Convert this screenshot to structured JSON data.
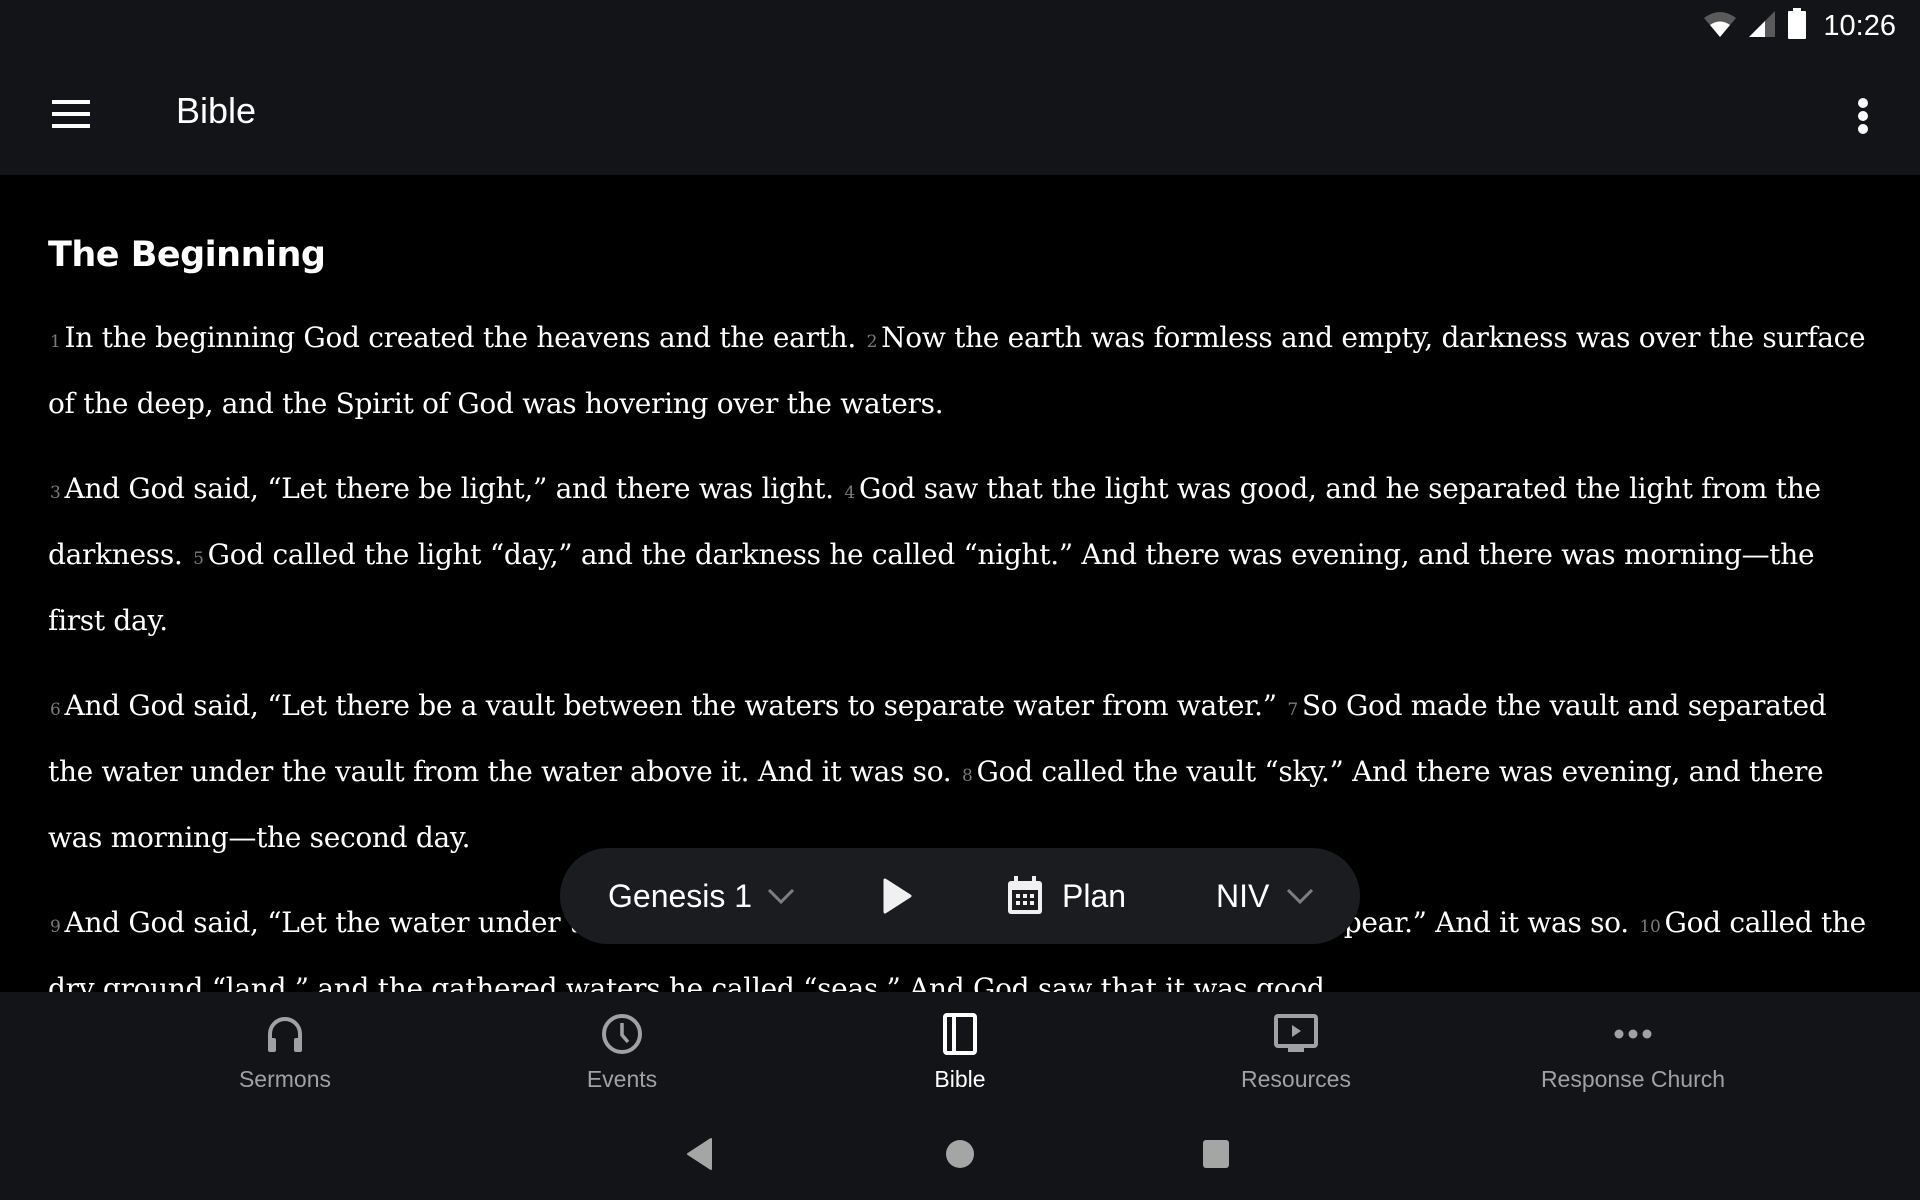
{
  "status_bar": {
    "time": "10:26",
    "icons": [
      "wifi-icon",
      "cell-signal-icon",
      "battery-icon"
    ]
  },
  "app_bar": {
    "title": "Bible",
    "menu_icon": "hamburger-menu-icon",
    "overflow_icon": "more-vert-icon"
  },
  "reader": {
    "section_title": "The Beginning",
    "paragraphs": [
      [
        {
          "num": "1",
          "text": "In the beginning God created the heavens and the earth."
        },
        {
          "num": "2",
          "text": "Now the earth was formless and empty, darkness was over the surface of the deep, and the Spirit of God was hovering over the waters."
        }
      ],
      [
        {
          "num": "3",
          "text": "And God said, “Let there be light,” and there was light."
        },
        {
          "num": "4",
          "text": "God saw that the light was good, and he separated the light from the darkness."
        },
        {
          "num": "5",
          "text": "God called the light “day,” and the darkness he called “night.” And there was evening, and there was morning—the first day."
        }
      ],
      [
        {
          "num": "6",
          "text": "And God said, “Let there be a vault between the waters to separate water from water.”"
        },
        {
          "num": "7",
          "text": "So God made the vault and separated the water under the vault from the water above it. And it was so."
        },
        {
          "num": "8",
          "text": "God called the vault “sky.” And there was evening, and there was morning—the second day."
        }
      ],
      [
        {
          "num": "9",
          "text": "And God said, “Let the water under the sky be gathered to one place, and let dry ground appear.” And it was so."
        },
        {
          "num": "10",
          "text": "God called the dry ground “land,” and the gathered waters he called “seas.” And God saw that it was good."
        }
      ]
    ]
  },
  "toolbar": {
    "chapter_label": "Genesis 1",
    "play_icon": "play-icon",
    "plan_label": "Plan",
    "version_label": "NIV"
  },
  "bottom_nav": {
    "items": [
      {
        "label": "Sermons",
        "icon": "headphones-icon",
        "active": false
      },
      {
        "label": "Events",
        "icon": "clock-icon",
        "active": false
      },
      {
        "label": "Bible",
        "icon": "book-icon",
        "active": true
      },
      {
        "label": "Resources",
        "icon": "tv-play-icon",
        "active": false
      },
      {
        "label": "Response Church",
        "icon": "more-horiz-icon",
        "active": false
      }
    ]
  },
  "system_nav": {
    "buttons": [
      "back",
      "home",
      "recents"
    ]
  },
  "colors": {
    "bar_bg": "#131417",
    "content_bg": "#000000",
    "pill_bg": "#1b1c1f",
    "inactive": "#a0a1a3",
    "verse_number": "#7a7a7a"
  }
}
